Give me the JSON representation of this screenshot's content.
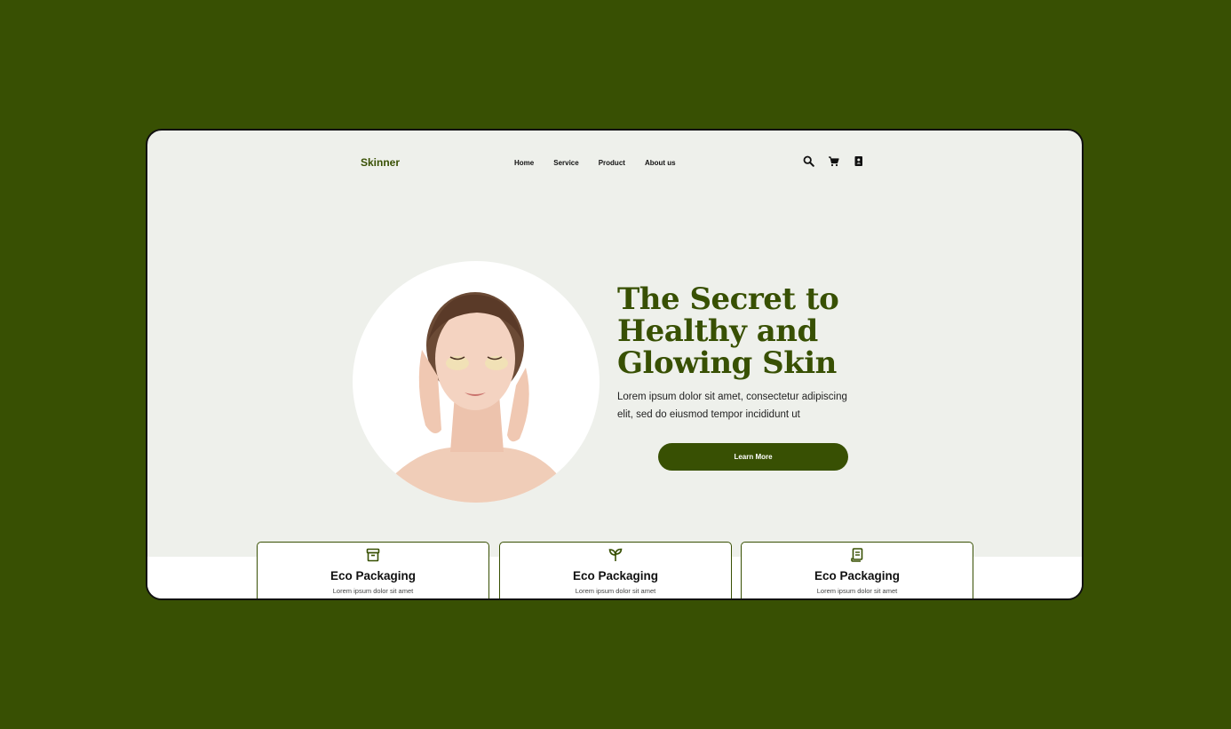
{
  "brand": {
    "name": "Skinner",
    "accent_color": "#385003"
  },
  "nav": {
    "items": [
      "Home",
      "Service",
      "Product",
      "About us"
    ]
  },
  "header_icons": [
    "search-icon",
    "cart-icon",
    "contact-book-icon"
  ],
  "hero": {
    "headline_lines": [
      "The Secret to",
      "Healthy and",
      "Glowing Skin"
    ],
    "body_lines": [
      "Lorem ipsum dolor sit amet, consectetur adipiscing",
      "elit, sed do eiusmod tempor incididunt ut"
    ],
    "cta_label": "Learn More"
  },
  "features": [
    {
      "icon": "archive-box-icon",
      "title": "Eco Packaging",
      "desc": "Lorem ipsum dolor sit amet"
    },
    {
      "icon": "sprout-icon",
      "title": "Eco Packaging",
      "desc": "Lorem ipsum dolor sit amet"
    },
    {
      "icon": "document-scroll-icon",
      "title": "Eco Packaging",
      "desc": "Lorem ipsum dolor sit amet"
    }
  ]
}
